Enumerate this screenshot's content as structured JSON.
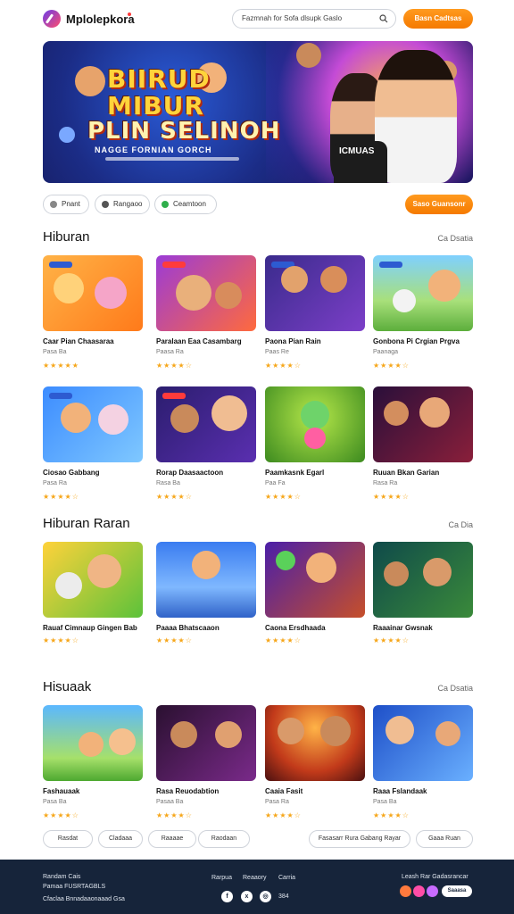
{
  "header": {
    "brand": "Mplolepkora",
    "search_placeholder": "Fazmnah for Sofa dlsupk Gaslo",
    "cta": "Basn Cadtsas"
  },
  "hero": {
    "title_line1": "BIIRUD",
    "title_line2": "MIBUR",
    "title_line3": "PLIN SELINOH",
    "subtitle": "NAGGE FORNIAN GORCH",
    "shirt_text": "ICMUAS",
    "colors": {
      "accent_orange": "#ff9a1f",
      "hero_blue": "#1b2c86"
    }
  },
  "filters": {
    "chips": [
      "Pnant",
      "Rangaoo",
      "Ceamtoon"
    ],
    "cta": "Saso Guansonr"
  },
  "sections": [
    {
      "title": "Hiburan",
      "more": "Ca Dsatia",
      "cards": [
        {
          "title": "Caar Pian Chaasaraa",
          "sub": "Pasa Ba",
          "rating": "★★★★★"
        },
        {
          "title": "Paralaan Eaa Casambarg",
          "sub": "Paasa Ra",
          "rating": "★★★★☆"
        },
        {
          "title": "Paona Pian Rain",
          "sub": "Paas Re",
          "rating": "★★★★☆"
        },
        {
          "title": "Gonbona Pi Crgian Prgva",
          "sub": "Paanaga",
          "rating": "★★★★☆"
        },
        {
          "title": "Ciosao Gabbang",
          "sub": "Pasa Ra",
          "rating": "★★★★☆"
        },
        {
          "title": "Rorap Daasaactoon",
          "sub": "Rasa Ba",
          "rating": "★★★★☆"
        },
        {
          "title": "Paamkasnk Egarl",
          "sub": "Paa Fa",
          "rating": "★★★★☆"
        },
        {
          "title": "Ruuan Bkan Garian",
          "sub": "Rasa Ra",
          "rating": "★★★★☆"
        }
      ]
    },
    {
      "title": "Hiburan Raran",
      "more": "Ca Dia",
      "cards": [
        {
          "title": "Rauaf Cimnaup Gingen Bab",
          "sub": "",
          "rating": "★★★★☆"
        },
        {
          "title": "Paaaa Bhatscaaon",
          "sub": "",
          "rating": "★★★★☆"
        },
        {
          "title": "Caona Ersdhaada",
          "sub": "",
          "rating": "★★★★☆"
        },
        {
          "title": "Raaainar Gwsnak",
          "sub": "",
          "rating": "★★★★☆"
        }
      ]
    },
    {
      "title": "Hisuaak",
      "more": "Ca Dsatia",
      "cards": [
        {
          "title": "Fashauaak",
          "sub": "Pasa Ba",
          "rating": "★★★★☆"
        },
        {
          "title": "Rasa Reuodabtion",
          "sub": "Pasaa Ba",
          "rating": "★★★★☆"
        },
        {
          "title": "Caaia Fasit",
          "sub": "Pasa Ra",
          "rating": "★★★★☆"
        },
        {
          "title": "Raaa Fslandaak",
          "sub": "Pasa Ba",
          "rating": "★★★★☆"
        }
      ]
    }
  ],
  "bottom_chips": [
    "Rasdat",
    "Cladaaa",
    "Raaaae",
    "Raodaan",
    "Fasasarr Rura Gabang Rayar",
    "Gaaa Ruan"
  ],
  "footer": {
    "left_line1": "Randam Cais",
    "left_line2": "Pamaa FUSRTAGBLS",
    "left_line3": "Cfaclaa Bnnadaaonaaad Gsa",
    "links": [
      "Rarpua",
      "Reaaory",
      "Carria"
    ],
    "social_count": "384",
    "right_text": "Leash Rar Gadasrancar",
    "right_pill": "Saaasa"
  }
}
